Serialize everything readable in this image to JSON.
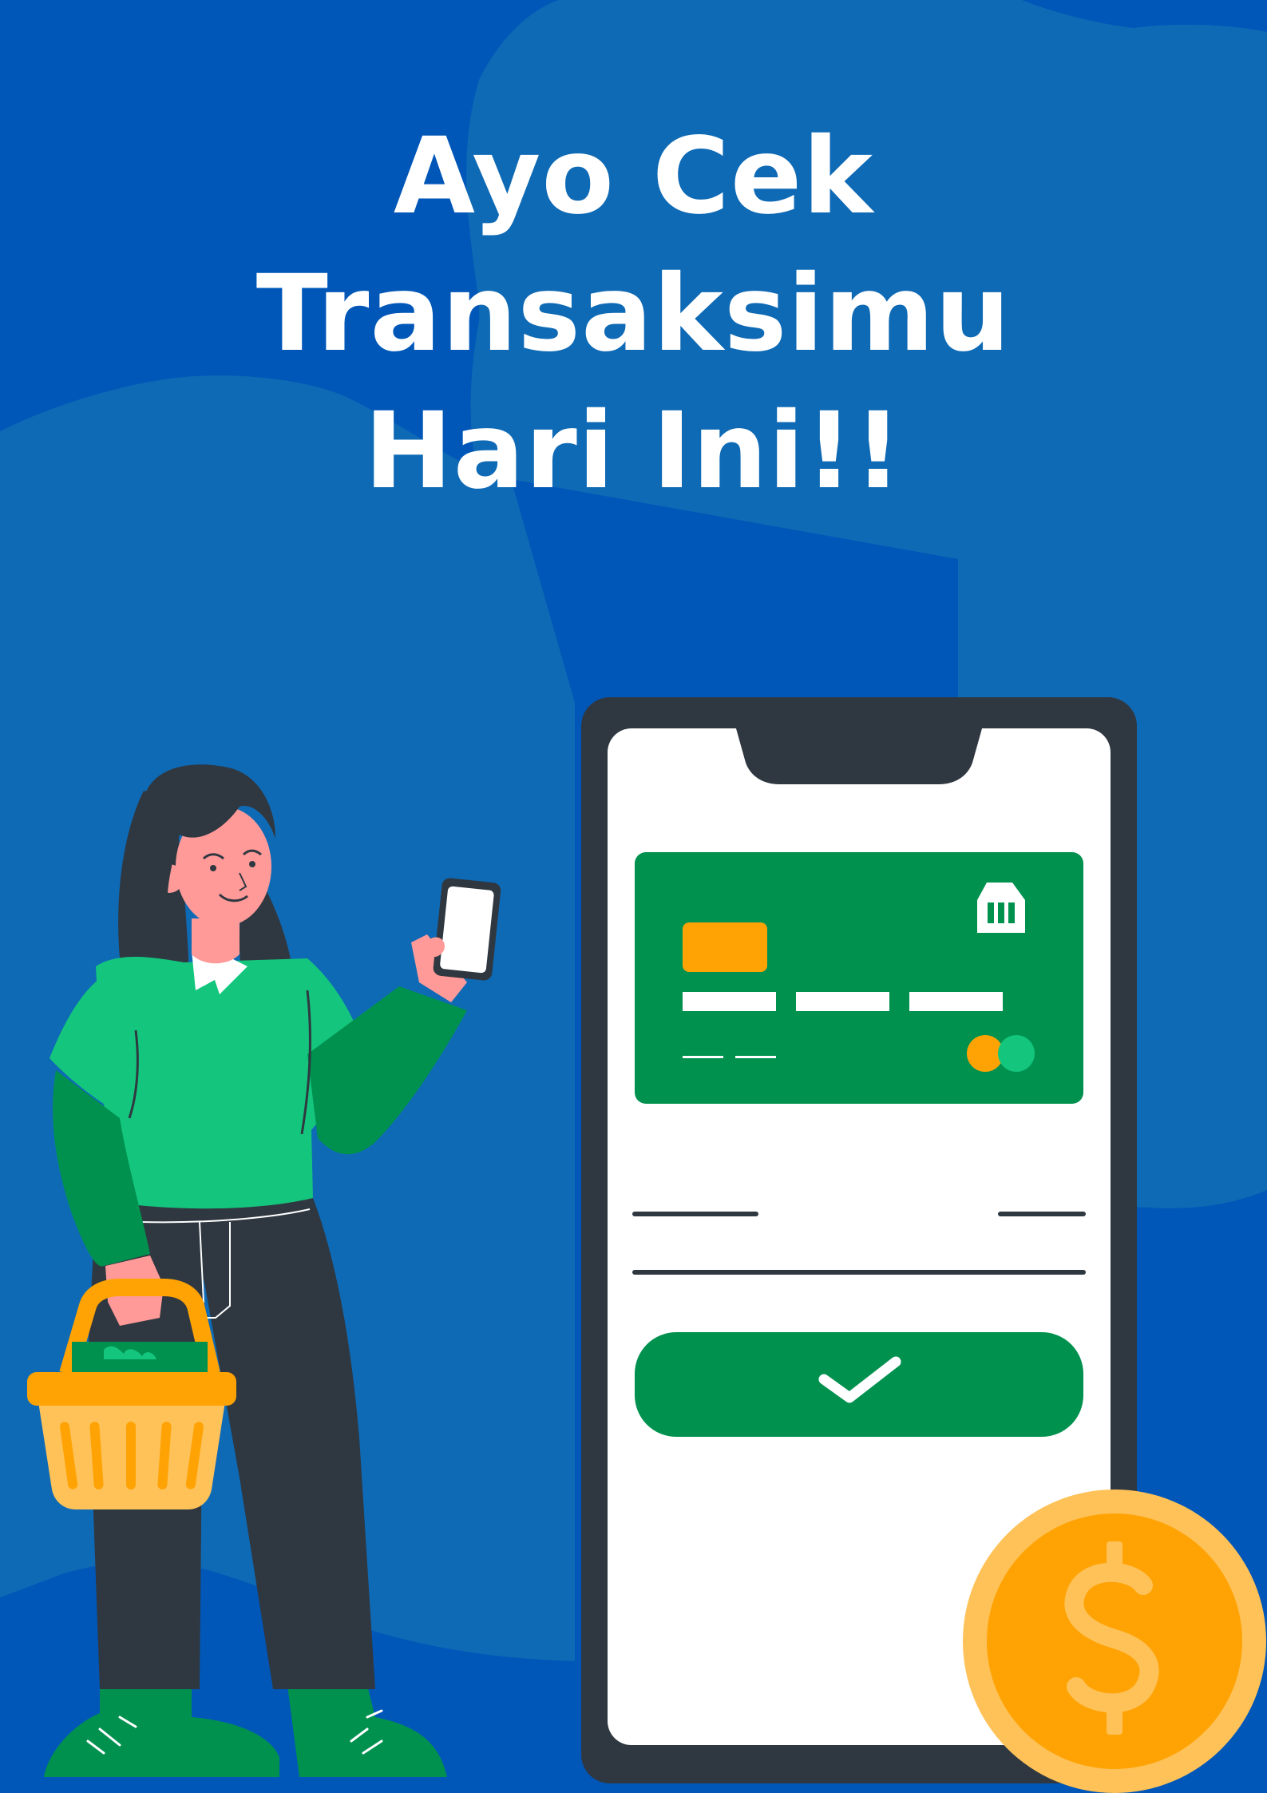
{
  "headline": {
    "line1": "Ayo Cek Transaksimu",
    "line2": "Hari Ini!!"
  },
  "colors": {
    "background": "#0057b8",
    "blob": "#0f6ab5",
    "phone_frame": "#2f3841",
    "screen": "#ffffff",
    "card": "#00914f",
    "card_chip": "#ffa305",
    "confirm_button": "#00914f",
    "coin_outer": "#ffc258",
    "coin_inner": "#ffa305",
    "shirt": "#14c67d",
    "sleeve": "#00914f",
    "skin": "#ff9a98",
    "hair": "#2f3841",
    "basket": "#ffa305"
  },
  "icons": {
    "card_chip": "chip-icon",
    "bank": "bank-icon",
    "card_brand": "card-brand-icon",
    "confirm": "checkmark-icon",
    "coin": "dollar-coin-icon"
  }
}
